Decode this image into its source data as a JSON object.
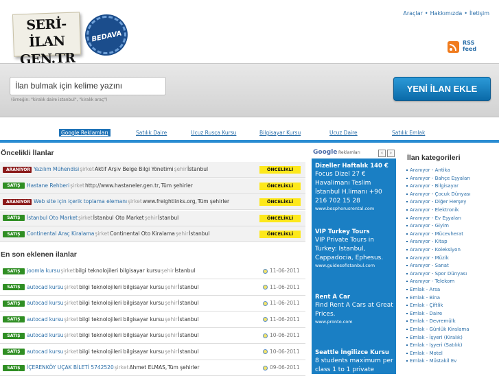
{
  "header": {
    "logo_line1": "SERİ-İLAN",
    "logo_line2": "GEN.TR",
    "seal_text": "BEDAVA",
    "toplinks": [
      "Araçlar",
      "Hakkımızda",
      "İletişim"
    ],
    "rss_label": "RSS feed"
  },
  "search": {
    "placeholder": "İlan bulmak için kelime yazını",
    "hint": "(örneğin: \"kiralık daire istanbul\", \"kiralık araç\")",
    "new_button": "YENİ İLAN EKLE"
  },
  "adlinks": {
    "google_label": "Google Reklamları",
    "links": [
      "Satılık Daire",
      "Ucuz Rusça Kursu",
      "Bilgisayar Kursu",
      "Ucuz Daire",
      "Satılık Emlak"
    ]
  },
  "priority": {
    "title": "Öncelikli İlanlar",
    "badge_label": "ÖNCELİKLİ",
    "rows": [
      {
        "type": "ARANIYOR",
        "title": "Yazılım Mühendisi",
        "company_label": "şirket",
        "company": "Aktif Arşiv Belge Bilgi Yönetimi",
        "city_label": "şehir",
        "city": "İstanbul"
      },
      {
        "type": "SATIŞ",
        "title": "Hastane Rehberi",
        "company_label": "şirket",
        "company": "http://www.hastaneler.gen.tr,",
        "city_label": "",
        "city": "Tüm şehirler"
      },
      {
        "type": "ARANIYOR",
        "title": "Web site için içerik toplama elemanı",
        "company_label": "şirket",
        "company": "www.freightlinks.org,",
        "city_label": "",
        "city": "Tüm şehirler"
      },
      {
        "type": "SATIŞ",
        "title": "İstanbul Oto Market",
        "company_label": "şirket",
        "company": "İstanbul Oto Market",
        "city_label": "şehir",
        "city": "İstanbul"
      },
      {
        "type": "SATIŞ",
        "title": "Continental Araç Kiralama",
        "company_label": "şirket",
        "company": "Continental Oto Kiralama",
        "city_label": "şehir",
        "city": "İstanbul"
      }
    ]
  },
  "latest": {
    "title": "En son eklenen ilanlar",
    "rows": [
      {
        "type": "SATIŞ",
        "title": "joomla kursu",
        "company_label": "şirket",
        "company": "bilgi teknolojileri bilgisayar kursu",
        "city_label": "şehir",
        "city": "İstanbul",
        "date": "11-06-2011"
      },
      {
        "type": "SATIŞ",
        "title": "autocad kursu",
        "company_label": "şirket",
        "company": "bilgi teknolojileri bilgisayar kursu",
        "city_label": "şehir",
        "city": "İstanbul",
        "date": "11-06-2011"
      },
      {
        "type": "SATIŞ",
        "title": "autocad kursu",
        "company_label": "şirket",
        "company": "bilgi teknolojileri bilgisayar kursu",
        "city_label": "şehir",
        "city": "İstanbul",
        "date": "11-06-2011"
      },
      {
        "type": "SATIŞ",
        "title": "autocad kursu",
        "company_label": "şirket",
        "company": "bilgi teknolojileri bilgisayar kursu",
        "city_label": "şehir",
        "city": "İstanbul",
        "date": "11-06-2011"
      },
      {
        "type": "SATIŞ",
        "title": "autocad kursu",
        "company_label": "şirket",
        "company": "bilgi teknolojileri bilgisayar kursu",
        "city_label": "şehir",
        "city": "İstanbul",
        "date": "10-06-2011"
      },
      {
        "type": "SATIŞ",
        "title": "autocad kursu",
        "company_label": "şirket",
        "company": "bilgi teknolojileri bilgisayar kursu",
        "city_label": "şehir",
        "city": "İstanbul",
        "date": "10-06-2011"
      },
      {
        "type": "SATIŞ",
        "title": "İÇERENKÖY UÇAK BİLETİ 5742520",
        "company_label": "şirket",
        "company": "Ahmet ELMAS,",
        "city_label": "",
        "city": "Tüm şehirler",
        "date": "09-06-2011"
      }
    ]
  },
  "ads": {
    "google_label": "Google",
    "ads_label": "Reklamları",
    "items": [
      {
        "headline": "Dizeller Haftalık 140 €",
        "body": "Focus Dizel 27 € Havalimanı Teslim İstanbul H.limanı +90 216 702 15 28",
        "url": "www.bosphorusrental.com"
      },
      {
        "headline": "VIP Turkey Tours",
        "body": "VIP Private Tours in Turkey: Istanbul, Cappadocia, Ephesus.",
        "url": "www.guidesofistanbul.com"
      },
      {
        "headline": "Rent A Car",
        "body": "Find Rent A Cars at Great Prices.",
        "url": "www.pronto.com"
      },
      {
        "headline": "Seattle İngilizce Kursu",
        "body": "8 students maximum per class 1 to 1 private",
        "url": ""
      }
    ]
  },
  "categories": {
    "title": "İlan kategorileri",
    "items": [
      "Aranıyor - Antika",
      "Aranıyor - Bahçe Eşyaları",
      "Aranıyor - Bilgisayar",
      "Aranıyor - Çocuk Dünyası",
      "Aranıyor - Diğer Herşey",
      "Aranıyor - Elektronik",
      "Aranıyor - Ev Eşyaları",
      "Aranıyor - Giyim",
      "Aranıyor - Mücevherat",
      "Aranıyor - Kitap",
      "Aranıyor - Koleksiyon",
      "Aranıyor - Müzik",
      "Aranıyor - Sanat",
      "Aranıyor - Spor Dünyası",
      "Aranıyor - Telekom",
      "Emlak - Arsa",
      "Emlak - Bina",
      "Emlak - Çiftlik",
      "Emlak - Daire",
      "Emlak - Devremülk",
      "Emlak - Günlük Kiralama",
      "Emlak - İşyeri (Kiralık)",
      "Emlak - İşyeri (Satılık)",
      "Emlak - Motel",
      "Emlak - Müstakil Ev"
    ]
  }
}
